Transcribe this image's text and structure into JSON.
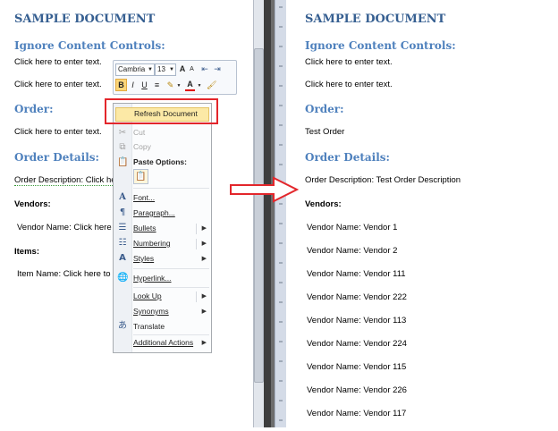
{
  "left_doc": {
    "title": "SAMPLE DOCUMENT",
    "h1": "Ignore Content Controls:",
    "p1": "Click here to enter text.",
    "p2": "Click here to enter text.",
    "h2": "Order:",
    "p3": "Click here to enter text.",
    "h3": "Order Details:",
    "desc": "Order Description: Click he",
    "vendors": "Vendors:",
    "vendor_line": "Vendor Name: Click here",
    "items": "Items:",
    "item_line": "Item Name: Click here to"
  },
  "minibar": {
    "font": "Cambria",
    "size": "13",
    "grow": "A",
    "shrink": "A",
    "bold": "B",
    "italic": "I",
    "underline": "U"
  },
  "context_menu": {
    "refresh": "Refresh Document",
    "cut": "Cut",
    "copy": "Copy",
    "paste_options": "Paste Options:",
    "font": "Font...",
    "paragraph": "Paragraph...",
    "bullets": "Bullets",
    "numbering": "Numbering",
    "styles": "Styles",
    "hyperlink": "Hyperlink...",
    "lookup": "Look Up",
    "synonyms": "Synonyms",
    "translate": "Translate",
    "additional": "Additional Actions"
  },
  "right_doc": {
    "title": "SAMPLE DOCUMENT",
    "h1": "Ignore Content Controls:",
    "p1": "Click here to enter text.",
    "p2": "Click here to enter text.",
    "h2": "Order:",
    "order": "Test Order",
    "h3": "Order Details:",
    "desc": "Order Description: Test Order Description",
    "vendors": "Vendors:",
    "vendor_lines": [
      "Vendor Name: Vendor 1",
      "Vendor Name: Vendor 2",
      "Vendor Name: Vendor 111",
      "Vendor Name: Vendor 222",
      "Vendor Name: Vendor 113",
      "Vendor Name: Vendor 224",
      "Vendor Name: Vendor 115",
      "Vendor Name: Vendor 226",
      "Vendor Name: Vendor 117"
    ]
  },
  "colors": {
    "heading_blue": "#4f81bd",
    "title_blue": "#365f91",
    "highlight_red": "#e3262b",
    "menu_highlight": "#fce9a6"
  },
  "icons": [
    "scissors-icon",
    "copy-icon",
    "clipboard-icon",
    "font-icon",
    "paragraph-icon",
    "bullets-icon",
    "numbering-icon",
    "styles-icon",
    "hyperlink-icon",
    "translate-icon",
    "arrow-right-icon"
  ]
}
